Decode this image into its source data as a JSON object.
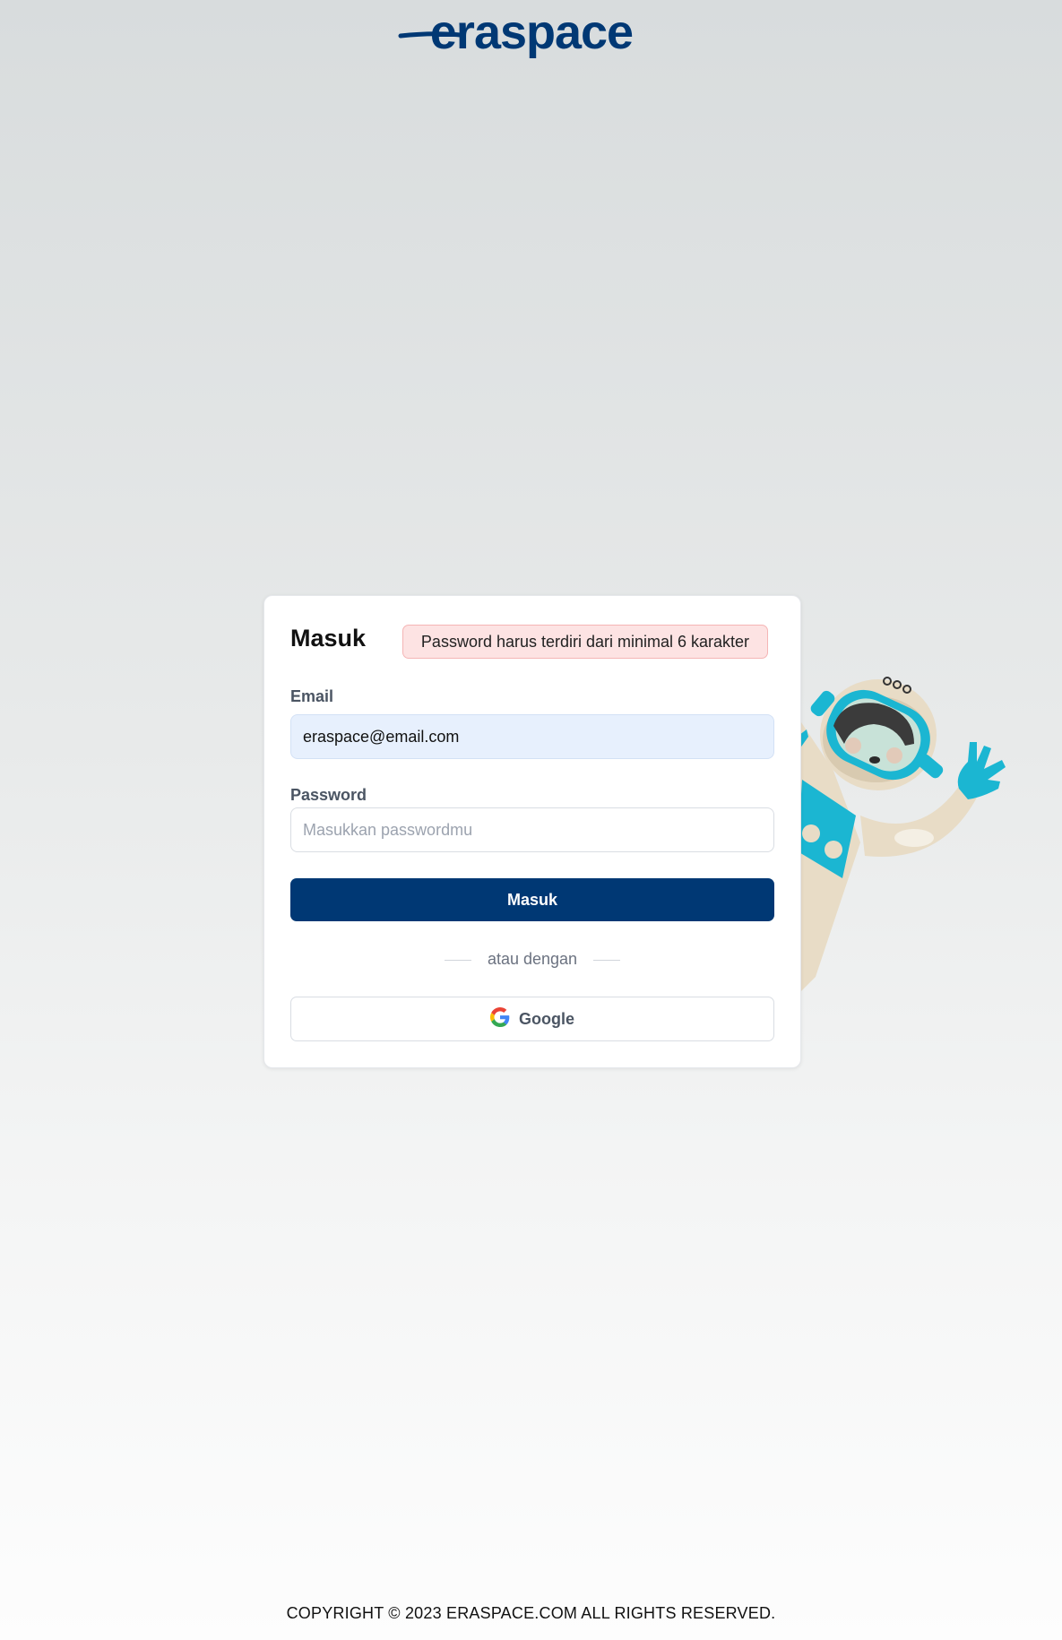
{
  "brand": {
    "name": "eraspace",
    "color": "#003874"
  },
  "login": {
    "title": "Masuk",
    "alert_message": "Password harus terdiri dari minimal 6 karakter",
    "email_label": "Email",
    "email_value": "eraspace@email.com",
    "password_label": "Password",
    "password_placeholder": "Masukkan passwordmu",
    "submit_label": "Masuk",
    "divider_text": "atau dengan",
    "google_label": "Google"
  },
  "footer": {
    "copyright": "COPYRIGHT © 2023 ERASPACE.COM ALL RIGHTS RESERVED."
  },
  "colors": {
    "primary": "#003874",
    "alert_bg": "#fde3e3",
    "input_filled_bg": "#e7f0fd",
    "astronaut_accent": "#1bb6d2"
  },
  "icons": {
    "google": "google-icon",
    "astronaut": "astronaut-illustration"
  }
}
